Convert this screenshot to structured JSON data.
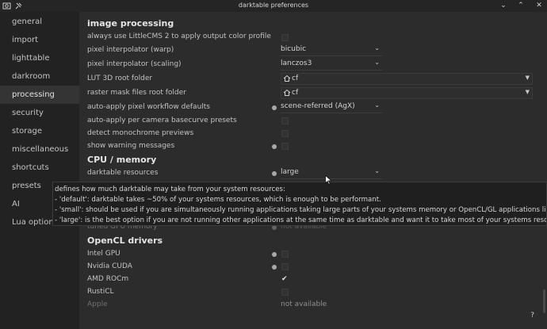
{
  "window": {
    "title": "darktable preferences"
  },
  "sidebar": {
    "items": [
      {
        "label": "general"
      },
      {
        "label": "import"
      },
      {
        "label": "lighttable"
      },
      {
        "label": "darkroom"
      },
      {
        "label": "processing",
        "active": true
      },
      {
        "label": "security"
      },
      {
        "label": "storage"
      },
      {
        "label": "miscellaneous"
      },
      {
        "label": "shortcuts"
      },
      {
        "label": "presets"
      },
      {
        "label": "AI"
      },
      {
        "label": "Lua options"
      }
    ]
  },
  "sections": {
    "image_processing": "image processing",
    "cpu_memory": "CPU / memory",
    "opencl": "OpenCL drivers"
  },
  "settings": {
    "littlecms": {
      "label": "always use LittleCMS 2 to apply output color profile",
      "checked": false
    },
    "interp_warp": {
      "label": "pixel interpolator (warp)",
      "value": "bicubic"
    },
    "interp_scaling": {
      "label": "pixel interpolator (scaling)",
      "value": "lanczos3"
    },
    "lut3d": {
      "label": "LUT 3D root folder",
      "value": "cf"
    },
    "raster_mask": {
      "label": "raster mask files root folder",
      "value": "cf"
    },
    "workflow": {
      "label": "auto-apply pixel workflow defaults",
      "value": "scene-referred (AgX)"
    },
    "basecurve": {
      "label": "auto-apply per camera basecurve presets",
      "checked": false
    },
    "monochrome": {
      "label": "detect monochrome previews",
      "checked": false
    },
    "warnings": {
      "label": "show warning messages",
      "checked": false
    },
    "resources": {
      "label": "darktable resources",
      "value": "large"
    },
    "tuned_gpu": {
      "label": "tuned GPU memory",
      "value": "not available"
    },
    "intel_gpu": {
      "label": "Intel GPU",
      "checked": false
    },
    "nvidia_cuda": {
      "label": "Nvidia CUDA",
      "checked": false
    },
    "amd_rocm": {
      "label": "AMD ROCm",
      "checked": true
    },
    "rusticl": {
      "label": "RustiCL",
      "checked": false
    },
    "apple": {
      "label": "Apple",
      "value": "not available"
    }
  },
  "tooltip": {
    "lines": [
      "defines how much darktable may take from your system resources:",
      " - 'default': darktable takes ~50% of your systems resources, which is enough to be performant.",
      " - 'small': should be used if you are simultaneously running applications taking large parts of your systems memory or OpenCL/GL applications like games",
      " - 'large': is the best option if you are not running other applications at the same time as darktable and want it to take most of your systems resources"
    ]
  },
  "footer": {
    "help_label": "?"
  },
  "icons": {
    "app": "darktable-app-icon",
    "pin": "pin-icon",
    "minimize": "chevron-down-icon",
    "maximize": "chevron-up-icon",
    "close": "close-icon",
    "folder": "home-icon"
  }
}
